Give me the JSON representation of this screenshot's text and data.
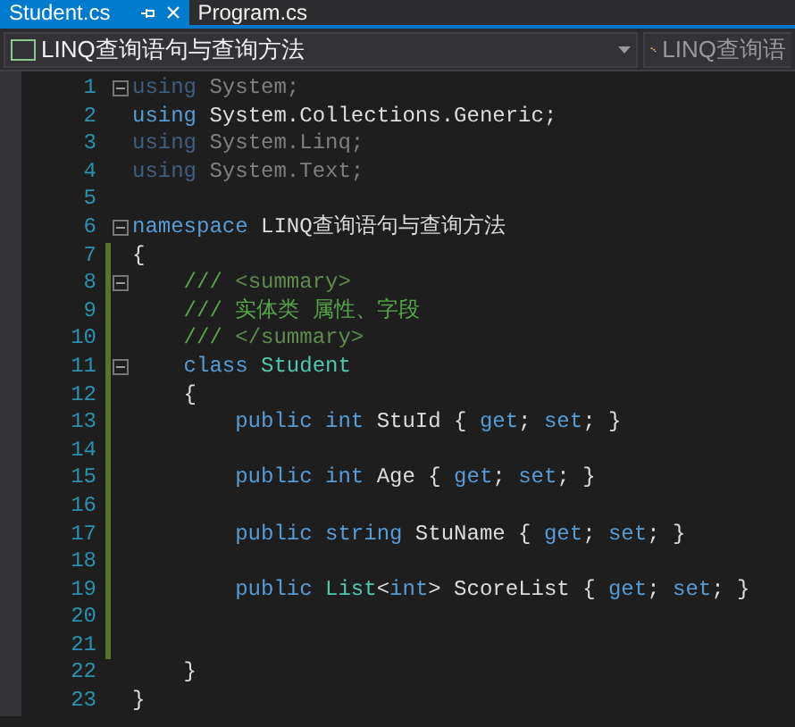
{
  "tabs": [
    {
      "label": "Student.cs",
      "selected": true,
      "pinned": true,
      "closable": true
    },
    {
      "label": "Program.cs",
      "selected": false,
      "pinned": false,
      "closable": false
    }
  ],
  "navigation_bar": {
    "project": "LINQ查询语句与查询方法",
    "member": "LINQ查询语"
  },
  "lines": [
    {
      "number": "1",
      "collapsible": true,
      "changed": false,
      "tokens": [
        {
          "kind": "keyword_dim",
          "text": "using"
        },
        {
          "kind": "plain_dim",
          "text": " System;"
        }
      ]
    },
    {
      "number": "2",
      "collapsible": false,
      "changed": false,
      "tokens": [
        {
          "kind": "keyword",
          "text": "using"
        },
        {
          "kind": "plain",
          "text": " System.Collections.Generic;"
        }
      ]
    },
    {
      "number": "3",
      "collapsible": false,
      "changed": false,
      "tokens": [
        {
          "kind": "keyword_dim",
          "text": "using"
        },
        {
          "kind": "plain_dim",
          "text": " System.Linq;"
        }
      ]
    },
    {
      "number": "4",
      "collapsible": false,
      "changed": false,
      "tokens": [
        {
          "kind": "keyword_dim",
          "text": "using"
        },
        {
          "kind": "plain_dim",
          "text": " System.Text;"
        }
      ]
    },
    {
      "number": "5",
      "collapsible": false,
      "changed": false
    },
    {
      "number": "6",
      "collapsible": true,
      "changed": false,
      "tokens": [
        {
          "kind": "keyword",
          "text": "namespace"
        },
        {
          "kind": "plain",
          "text": " LINQ查询语句与查询方法"
        }
      ]
    },
    {
      "number": "7",
      "collapsible": false,
      "changed": true,
      "tokens": [
        {
          "kind": "plain",
          "text": "{"
        }
      ]
    },
    {
      "number": "8",
      "collapsible": true,
      "changed": true,
      "tokens": [
        {
          "kind": "comment",
          "text": "    ///"
        },
        {
          "kind": "doc_tag",
          "text": " <summary>"
        }
      ]
    },
    {
      "number": "9",
      "collapsible": false,
      "changed": true,
      "tokens": [
        {
          "kind": "comment",
          "text": "    /// 实体类 属性、字段"
        }
      ]
    },
    {
      "number": "10",
      "collapsible": false,
      "changed": true,
      "tokens": [
        {
          "kind": "comment",
          "text": "    ///"
        },
        {
          "kind": "doc_tag",
          "text": " </summary>"
        }
      ]
    },
    {
      "number": "11",
      "collapsible": true,
      "changed": true,
      "tokens": [
        {
          "kind": "keyword",
          "text": "    class"
        },
        {
          "kind": "type",
          "text": " Student"
        }
      ]
    },
    {
      "number": "12",
      "collapsible": false,
      "changed": true,
      "tokens": [
        {
          "kind": "plain",
          "text": "    {"
        }
      ]
    },
    {
      "number": "13",
      "collapsible": false,
      "changed": true,
      "tokens": [
        {
          "kind": "keyword",
          "text": "        public int"
        },
        {
          "kind": "plain",
          "text": " StuId { "
        },
        {
          "kind": "keyword",
          "text": "get"
        },
        {
          "kind": "plain",
          "text": "; "
        },
        {
          "kind": "keyword",
          "text": "set"
        },
        {
          "kind": "plain",
          "text": "; }"
        }
      ]
    },
    {
      "number": "14",
      "collapsible": false,
      "changed": true
    },
    {
      "number": "15",
      "collapsible": false,
      "changed": true,
      "tokens": [
        {
          "kind": "keyword",
          "text": "        public int"
        },
        {
          "kind": "plain",
          "text": " Age { "
        },
        {
          "kind": "keyword",
          "text": "get"
        },
        {
          "kind": "plain",
          "text": "; "
        },
        {
          "kind": "keyword",
          "text": "set"
        },
        {
          "kind": "plain",
          "text": "; }"
        }
      ]
    },
    {
      "number": "16",
      "collapsible": false,
      "changed": true
    },
    {
      "number": "17",
      "collapsible": false,
      "changed": true,
      "tokens": [
        {
          "kind": "keyword",
          "text": "        public string"
        },
        {
          "kind": "plain",
          "text": " StuName { "
        },
        {
          "kind": "keyword",
          "text": "get"
        },
        {
          "kind": "plain",
          "text": "; "
        },
        {
          "kind": "keyword",
          "text": "set"
        },
        {
          "kind": "plain",
          "text": "; }"
        }
      ]
    },
    {
      "number": "18",
      "collapsible": false,
      "changed": true
    },
    {
      "number": "19",
      "collapsible": false,
      "changed": true,
      "tokens": [
        {
          "kind": "keyword",
          "text": "        public"
        },
        {
          "kind": "type",
          "text": " List"
        },
        {
          "kind": "plain",
          "text": "<"
        },
        {
          "kind": "keyword",
          "text": "int"
        },
        {
          "kind": "plain",
          "text": "> ScoreList { "
        },
        {
          "kind": "keyword",
          "text": "get"
        },
        {
          "kind": "plain",
          "text": "; "
        },
        {
          "kind": "keyword",
          "text": "set"
        },
        {
          "kind": "plain",
          "text": "; }"
        }
      ]
    },
    {
      "number": "20",
      "collapsible": false,
      "changed": true
    },
    {
      "number": "21",
      "collapsible": false,
      "changed": true
    },
    {
      "number": "22",
      "collapsible": false,
      "changed": false,
      "tokens": [
        {
          "kind": "plain",
          "text": "    }"
        }
      ]
    },
    {
      "number": "23",
      "collapsible": false,
      "changed": false,
      "tokens": [
        {
          "kind": "plain",
          "text": "}"
        }
      ]
    }
  ]
}
